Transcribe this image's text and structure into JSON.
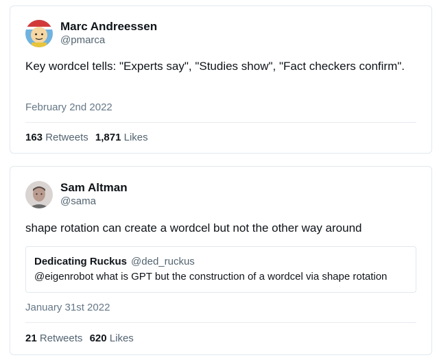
{
  "tweets": [
    {
      "author": "Marc Andreessen",
      "handle": "@pmarca",
      "avatar_icon": "cartoon-avatar-icon",
      "text": "Key wordcel tells: \"Experts say\", \"Studies show\", \"Fact checkers confirm\".",
      "date": "February 2nd 2022",
      "retweets": "163",
      "retweets_label": "Retweets",
      "likes": "1,871",
      "likes_label": "Likes"
    },
    {
      "author": "Sam Altman",
      "handle": "@sama",
      "avatar_icon": "photo-avatar-icon",
      "text": "shape rotation can create a wordcel but not the other way around",
      "quote": {
        "author": "Dedicating Ruckus",
        "handle": "@ded_ruckus",
        "text": "@eigenrobot what is GPT but the construction of a wordcel via shape rotation"
      },
      "date": "January 31st 2022",
      "retweets": "21",
      "retweets_label": "Retweets",
      "likes": "620",
      "likes_label": "Likes"
    }
  ],
  "colors": {
    "border": "#e1e8ed",
    "secondary_text": "#536471",
    "primary_text": "#0f1419"
  }
}
